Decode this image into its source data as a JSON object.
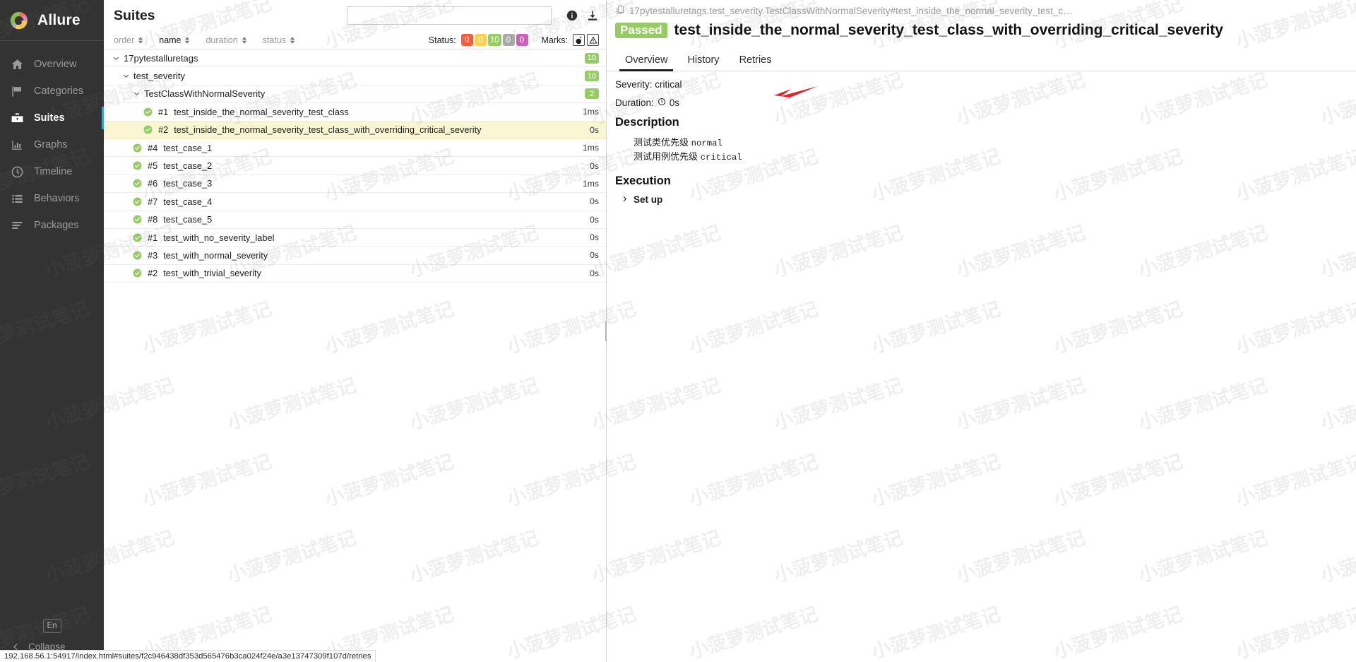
{
  "brand": {
    "name": "Allure",
    "logo_icon": "allure-logo-icon"
  },
  "sidebar": {
    "items": [
      {
        "label": "Overview",
        "icon": "home-icon",
        "active": false
      },
      {
        "label": "Categories",
        "icon": "flag-icon",
        "active": false
      },
      {
        "label": "Suites",
        "icon": "suitcase-icon",
        "active": true
      },
      {
        "label": "Graphs",
        "icon": "bar-chart-icon",
        "active": false
      },
      {
        "label": "Timeline",
        "icon": "clock-icon",
        "active": false
      },
      {
        "label": "Behaviors",
        "icon": "list-icon",
        "active": false
      },
      {
        "label": "Packages",
        "icon": "layers-icon",
        "active": false
      }
    ],
    "language_button": "En",
    "collapse_label": "Collapse",
    "collapse_icon": "chevron-left-icon"
  },
  "suites": {
    "title": "Suites",
    "search_placeholder": "",
    "search_value": "",
    "info_icon": "info-icon",
    "download_icon": "download-icon",
    "sorters": [
      {
        "label": "order"
      },
      {
        "label": "name"
      },
      {
        "label": "duration"
      },
      {
        "label": "status"
      }
    ],
    "status_filter_label": "Status:",
    "status_badges": [
      {
        "value": "0",
        "color": "#fd5a3e",
        "name": "failed"
      },
      {
        "value": "0",
        "color": "#ffd050",
        "name": "broken"
      },
      {
        "value": "10",
        "color": "#97cc64",
        "name": "passed"
      },
      {
        "value": "0",
        "color": "#aaaaaa",
        "name": "skipped"
      },
      {
        "value": "0",
        "color": "#d35ebe",
        "name": "unknown"
      }
    ],
    "marks_label": "Marks:",
    "marks": [
      {
        "icon": "bomb-icon",
        "name": "flaky-mark"
      },
      {
        "icon": "alert-triangle-icon",
        "name": "retries-mark"
      }
    ],
    "rows": [
      {
        "kind": "group",
        "indent": 0,
        "chevron": "⌄",
        "name": "17pytestalluretags",
        "badge": "10"
      },
      {
        "kind": "group",
        "indent": 1,
        "chevron": "⌄",
        "name": "test_severity",
        "badge": "10"
      },
      {
        "kind": "group",
        "indent": 2,
        "chevron": "⌄",
        "name": "TestClassWithNormalSeverity",
        "badge": "2"
      },
      {
        "kind": "test",
        "indent": 3,
        "status": "passed",
        "num": "#1",
        "name": "test_inside_the_normal_severity_test_class",
        "duration": "1ms",
        "selected": false
      },
      {
        "kind": "test",
        "indent": 3,
        "status": "passed",
        "num": "#2",
        "name": "test_inside_the_normal_severity_test_class_with_overriding_critical_severity",
        "duration": "0s",
        "selected": true
      },
      {
        "kind": "test",
        "indent": 2,
        "status": "passed",
        "num": "#4",
        "name": "test_case_1",
        "duration": "1ms",
        "selected": false
      },
      {
        "kind": "test",
        "indent": 2,
        "status": "passed",
        "num": "#5",
        "name": "test_case_2",
        "duration": "0s",
        "selected": false
      },
      {
        "kind": "test",
        "indent": 2,
        "status": "passed",
        "num": "#6",
        "name": "test_case_3",
        "duration": "1ms",
        "selected": false
      },
      {
        "kind": "test",
        "indent": 2,
        "status": "passed",
        "num": "#7",
        "name": "test_case_4",
        "duration": "0s",
        "selected": false
      },
      {
        "kind": "test",
        "indent": 2,
        "status": "passed",
        "num": "#8",
        "name": "test_case_5",
        "duration": "0s",
        "selected": false
      },
      {
        "kind": "test",
        "indent": 2,
        "status": "passed",
        "num": "#1",
        "name": "test_with_no_severity_label",
        "duration": "0s",
        "selected": false
      },
      {
        "kind": "test",
        "indent": 2,
        "status": "passed",
        "num": "#3",
        "name": "test_with_normal_severity",
        "duration": "0s",
        "selected": false
      },
      {
        "kind": "test",
        "indent": 2,
        "status": "passed",
        "num": "#2",
        "name": "test_with_trivial_severity",
        "duration": "0s",
        "selected": false
      }
    ]
  },
  "detail": {
    "copy_icon": "copy-icon",
    "breadcrumb": "17pytestalluretags.test_severity.TestClassWithNormalSeverity#test_inside_the_normal_severity_test_c…",
    "status_tag": "Passed",
    "title": "test_inside_the_normal_severity_test_class_with_overriding_critical_severity",
    "tabs": [
      {
        "label": "Overview",
        "active": true
      },
      {
        "label": "History",
        "active": false
      },
      {
        "label": "Retries",
        "active": false
      }
    ],
    "severity_line": "Severity: critical",
    "duration_label": "Duration:",
    "duration_icon": "clock-icon",
    "duration_value": "0s",
    "description_heading": "Description",
    "description_lines": [
      {
        "text": "测试类优先级 ",
        "code": "normal"
      },
      {
        "text": "测试用例优先级 ",
        "code": "critical"
      }
    ],
    "execution_heading": "Execution",
    "setup_label": "Set up",
    "setup_chevron": "›"
  },
  "statusbar": {
    "url": "192.168.56.1:54917/index.html#suites/f2c946438df353d565476b3ca024f24e/a3e13747309f107d/retries"
  },
  "colors": {
    "passed": "#97cc64",
    "failed": "#fd5a3e",
    "broken": "#ffd050",
    "skipped": "#aaaaaa",
    "unknown": "#d35ebe",
    "sidebar_bg": "#333333",
    "accent": "#34a3de",
    "selected_row": "#faf6d3",
    "annotation_arrow": "#ee1c25"
  },
  "watermark_text": "小菠萝测试笔记"
}
